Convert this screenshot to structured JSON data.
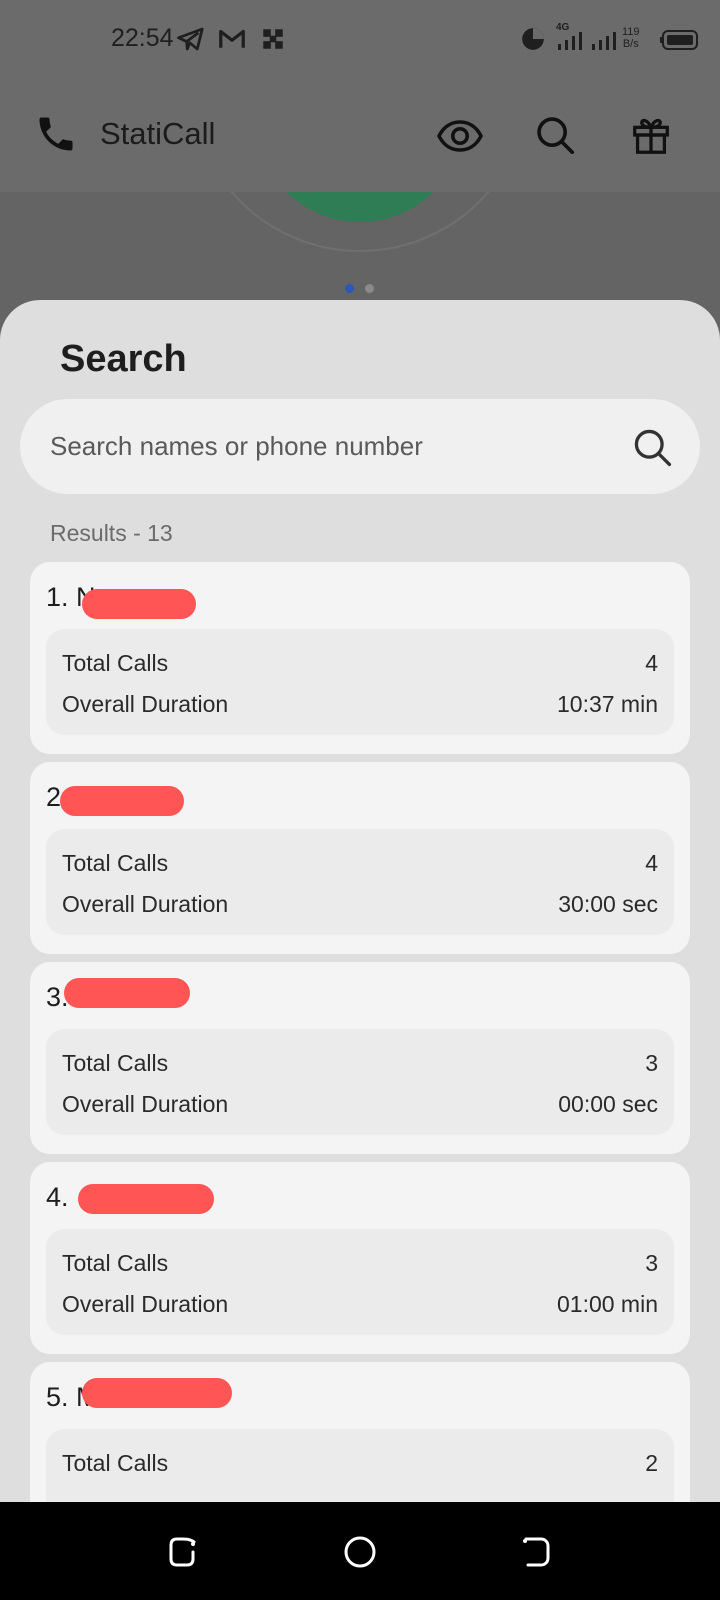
{
  "status_bar": {
    "time": "22:54",
    "network_type": "4G",
    "speed_value": "119",
    "speed_unit": "B/s",
    "icons": [
      "telegram-icon",
      "gmail-icon",
      "app-icon",
      "data-saver-icon",
      "signal-icon",
      "signal-icon",
      "battery-icon"
    ]
  },
  "app_bar": {
    "title": "StatiCall",
    "icons": [
      "phone-icon",
      "eye-icon",
      "search-icon",
      "gift-icon"
    ]
  },
  "search_sheet": {
    "title": "Search",
    "search_placeholder": "Search names or phone number",
    "results_label": "Results - 13",
    "stat_labels": {
      "total_calls": "Total Calls",
      "overall_duration": "Overall Duration"
    },
    "results": [
      {
        "index": "1. N",
        "total_calls": "4",
        "overall_duration": "10:37 min"
      },
      {
        "index": "2",
        "total_calls": "4",
        "overall_duration": "30:00 sec"
      },
      {
        "index": "3.",
        "total_calls": "3",
        "overall_duration": "00:00 sec"
      },
      {
        "index": "4.",
        "total_calls": "3",
        "overall_duration": "01:00 min"
      },
      {
        "index": "5. M",
        "total_calls": "2",
        "overall_duration": ""
      }
    ]
  },
  "colors": {
    "accent_green": "#2e7d55",
    "redaction": "#ff5555",
    "pager_active": "#2a57b8"
  }
}
